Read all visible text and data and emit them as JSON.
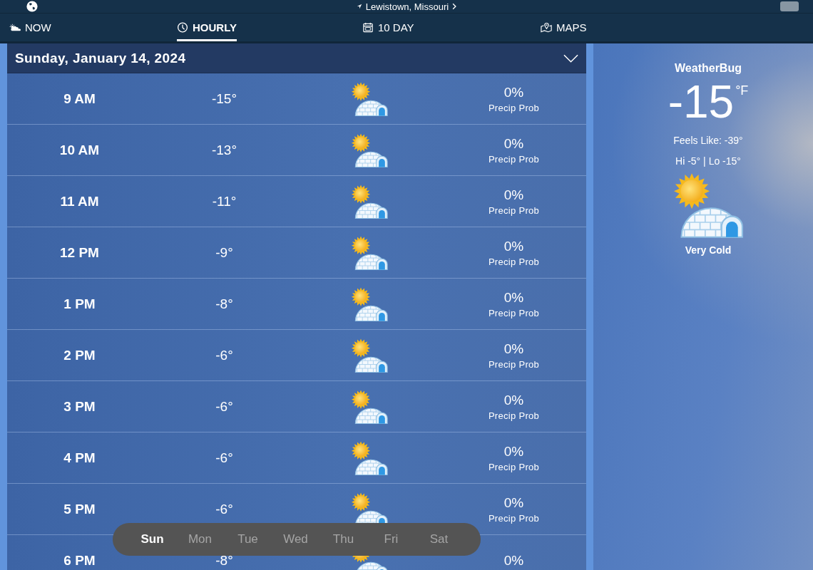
{
  "header": {
    "location": "Lewistown, Missouri"
  },
  "tabs": [
    {
      "label": "NOW",
      "kind": "current",
      "selected": false
    },
    {
      "label": "HOURLY",
      "kind": "hourly",
      "selected": true
    },
    {
      "label": "10 DAY",
      "kind": "daily",
      "selected": false
    },
    {
      "label": "MAPS",
      "kind": "map",
      "selected": false
    }
  ],
  "date_bar": {
    "label": "Sunday, January 14, 2024"
  },
  "hours": [
    {
      "time": "9 AM",
      "temp": "-15°",
      "precip": "0%",
      "precip_label": "Precip Prob"
    },
    {
      "time": "10 AM",
      "temp": "-13°",
      "precip": "0%",
      "precip_label": "Precip Prob"
    },
    {
      "time": "11 AM",
      "temp": "-11°",
      "precip": "0%",
      "precip_label": "Precip Prob"
    },
    {
      "time": "12 PM",
      "temp": "-9°",
      "precip": "0%",
      "precip_label": "Precip Prob"
    },
    {
      "time": "1 PM",
      "temp": "-8°",
      "precip": "0%",
      "precip_label": "Precip Prob"
    },
    {
      "time": "2 PM",
      "temp": "-6°",
      "precip": "0%",
      "precip_label": "Precip Prob"
    },
    {
      "time": "3 PM",
      "temp": "-6°",
      "precip": "0%",
      "precip_label": "Precip Prob"
    },
    {
      "time": "4 PM",
      "temp": "-6°",
      "precip": "0%",
      "precip_label": "Precip Prob"
    },
    {
      "time": "5 PM",
      "temp": "-6°",
      "precip": "0%",
      "precip_label": "Precip Prob"
    },
    {
      "time": "6 PM",
      "temp": "-8°",
      "precip": "0%"
    }
  ],
  "current": {
    "source": "WeatherBug",
    "temp": "-15",
    "unit": "°F",
    "feels_like": "Feels Like: -39°",
    "hi_lo": "Hi -5° | Lo -15°",
    "condition": "Very Cold"
  },
  "day_picker": [
    {
      "label": "Sun",
      "selected": true
    },
    {
      "label": "Mon",
      "selected": false
    },
    {
      "label": "Tue",
      "selected": false
    },
    {
      "label": "Wed",
      "selected": false
    },
    {
      "label": "Thu",
      "selected": false
    },
    {
      "label": "Fri",
      "selected": false
    },
    {
      "label": "Sat",
      "selected": false
    }
  ]
}
